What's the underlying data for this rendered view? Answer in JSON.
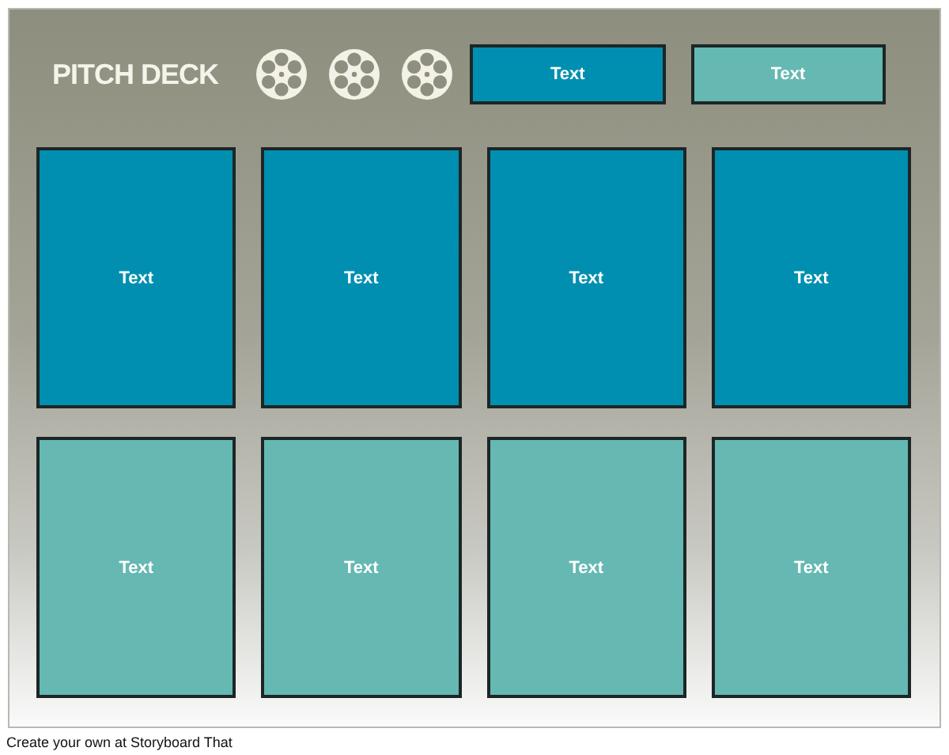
{
  "title": "PITCH DECK",
  "header_boxes": [
    {
      "text": "Text",
      "color": "#008fb0"
    },
    {
      "text": "Text",
      "color": "#66b8b2"
    }
  ],
  "card_rows": [
    {
      "cards": [
        {
          "text": "Text",
          "color": "#008fb0"
        },
        {
          "text": "Text",
          "color": "#008fb0"
        },
        {
          "text": "Text",
          "color": "#008fb0"
        },
        {
          "text": "Text",
          "color": "#008fb0"
        }
      ]
    },
    {
      "cards": [
        {
          "text": "Text",
          "color": "#66b8b2"
        },
        {
          "text": "Text",
          "color": "#66b8b2"
        },
        {
          "text": "Text",
          "color": "#66b8b2"
        },
        {
          "text": "Text",
          "color": "#66b8b2"
        }
      ]
    }
  ],
  "caption": "Create your own at Storyboard That"
}
